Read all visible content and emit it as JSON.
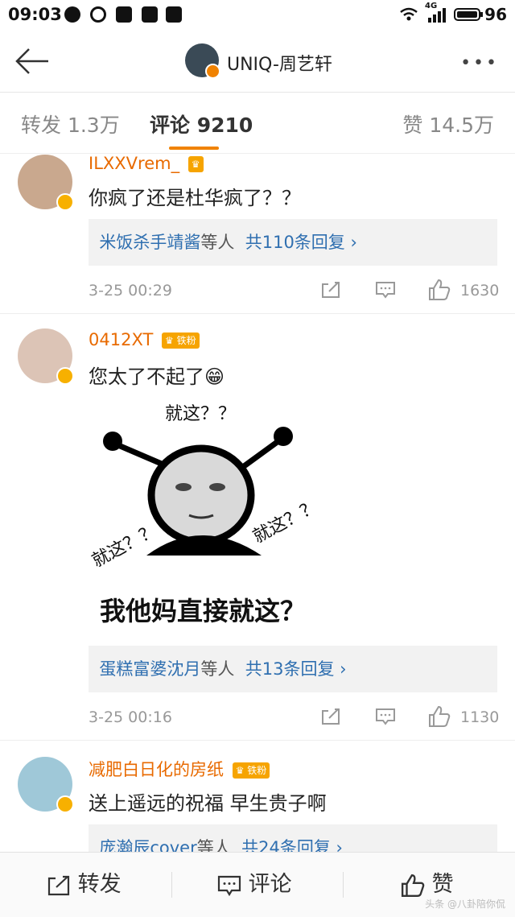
{
  "status_bar": {
    "time": "09:03",
    "network": "4G",
    "battery": "96"
  },
  "header": {
    "title": "UNIQ-周艺轩"
  },
  "tabs": [
    {
      "label": "转发 1.3万"
    },
    {
      "label": "评论 9210"
    },
    {
      "label": "赞 14.5万"
    }
  ],
  "comments": [
    {
      "username": "ILXXVrem_",
      "badge": "",
      "text": "你疯了还是杜华疯了？？",
      "reply_names": "米饭杀手靖酱",
      "reply_mid": "等人",
      "reply_count": "共110条回复 ›",
      "time": "3-25 00:29",
      "likes": "1630"
    },
    {
      "username": "0412XT",
      "badge": "铁粉",
      "text": "您太了不起了😁",
      "meme": {
        "t1": "就这？？",
        "t2": "就这？？",
        "t3": "就这？？",
        "caption": "我他妈直接就这？"
      },
      "reply_names": "蛋糕富婆沈月",
      "reply_mid": "等人",
      "reply_count": "共13条回复 ›",
      "time": "3-25 00:16",
      "likes": "1130"
    },
    {
      "username": "减肥白日化的房纸",
      "badge": "铁粉",
      "text": "送上遥远的祝福 早生贵子啊",
      "reply_names": "庞瀚辰cover",
      "reply_mid": "等人",
      "reply_count": "共24条回复 ›"
    }
  ],
  "bottom_bar": {
    "forward": "转发",
    "comment": "评论",
    "like": "赞"
  },
  "watermark": "头条 @八卦陪你侃"
}
